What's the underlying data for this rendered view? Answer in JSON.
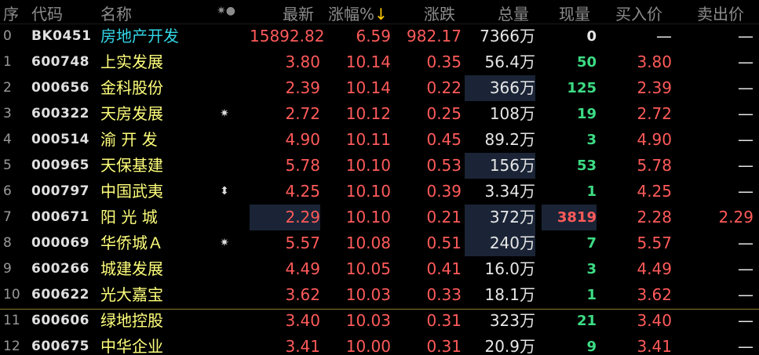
{
  "header": {
    "seq": "序",
    "code": "代码",
    "name": "名称",
    "mark": "✷●",
    "price": "最新",
    "pct": "涨幅%",
    "pct_arrow": "↓",
    "chg": "涨跌",
    "vol": "总量",
    "cur": "现量",
    "bid": "买入价",
    "ask": "卖出价"
  },
  "rows": [
    {
      "seq": "0",
      "code": "BK0451",
      "name": "房地产开发",
      "mark": "",
      "price": "15892.82",
      "pct": "6.59",
      "chg": "982.17",
      "vol": "7366万",
      "cur": "0",
      "bid": "—",
      "ask": "—"
    },
    {
      "seq": "1",
      "code": "600748",
      "name": "上实发展",
      "mark": "",
      "price": "3.80",
      "pct": "10.14",
      "chg": "0.35",
      "vol": "56.4万",
      "cur": "50",
      "bid": "3.80",
      "ask": "—"
    },
    {
      "seq": "2",
      "code": "000656",
      "name": "金科股份",
      "mark": "",
      "price": "2.39",
      "pct": "10.14",
      "chg": "0.22",
      "vol": "366万",
      "cur": "125",
      "bid": "2.39",
      "ask": "—"
    },
    {
      "seq": "3",
      "code": "600322",
      "name": "天房发展",
      "mark": "✷",
      "price": "2.72",
      "pct": "10.12",
      "chg": "0.25",
      "vol": "108万",
      "cur": "19",
      "bid": "2.72",
      "ask": "—"
    },
    {
      "seq": "4",
      "code": "000514",
      "name": "渝 开 发",
      "mark": "",
      "price": "4.90",
      "pct": "10.11",
      "chg": "0.45",
      "vol": "89.2万",
      "cur": "3",
      "bid": "4.90",
      "ask": "—"
    },
    {
      "seq": "5",
      "code": "000965",
      "name": "天保基建",
      "mark": "",
      "price": "5.78",
      "pct": "10.10",
      "chg": "0.53",
      "vol": "156万",
      "cur": "53",
      "bid": "5.78",
      "ask": "—"
    },
    {
      "seq": "6",
      "code": "000797",
      "name": "中国武夷",
      "mark": "⬍",
      "price": "4.25",
      "pct": "10.10",
      "chg": "0.39",
      "vol": "3.34万",
      "cur": "1",
      "bid": "4.25",
      "ask": "—"
    },
    {
      "seq": "7",
      "code": "000671",
      "name": "阳 光 城",
      "mark": "",
      "price": "2.29",
      "pct": "10.10",
      "chg": "0.21",
      "vol": "372万",
      "cur": "3819",
      "bid": "2.28",
      "ask": "2.29"
    },
    {
      "seq": "8",
      "code": "000069",
      "name": "华侨城Ａ",
      "mark": "✷",
      "price": "5.57",
      "pct": "10.08",
      "chg": "0.51",
      "vol": "240万",
      "cur": "7",
      "bid": "5.57",
      "ask": "—"
    },
    {
      "seq": "9",
      "code": "600266",
      "name": "城建发展",
      "mark": "",
      "price": "4.49",
      "pct": "10.05",
      "chg": "0.41",
      "vol": "16.0万",
      "cur": "3",
      "bid": "4.49",
      "ask": "—"
    },
    {
      "seq": "10",
      "code": "600622",
      "name": "光大嘉宝",
      "mark": "",
      "price": "3.62",
      "pct": "10.03",
      "chg": "0.33",
      "vol": "18.1万",
      "cur": "1",
      "bid": "3.62",
      "ask": "—"
    },
    {
      "seq": "11",
      "code": "600606",
      "name": "绿地控股",
      "mark": "",
      "price": "3.40",
      "pct": "10.03",
      "chg": "0.31",
      "vol": "323万",
      "cur": "21",
      "bid": "3.40",
      "ask": "—"
    },
    {
      "seq": "12",
      "code": "600675",
      "name": "中华企业",
      "mark": "",
      "price": "3.41",
      "pct": "10.00",
      "chg": "0.31",
      "vol": "20.9万",
      "cur": "9",
      "bid": "3.41",
      "ask": "—"
    }
  ]
}
